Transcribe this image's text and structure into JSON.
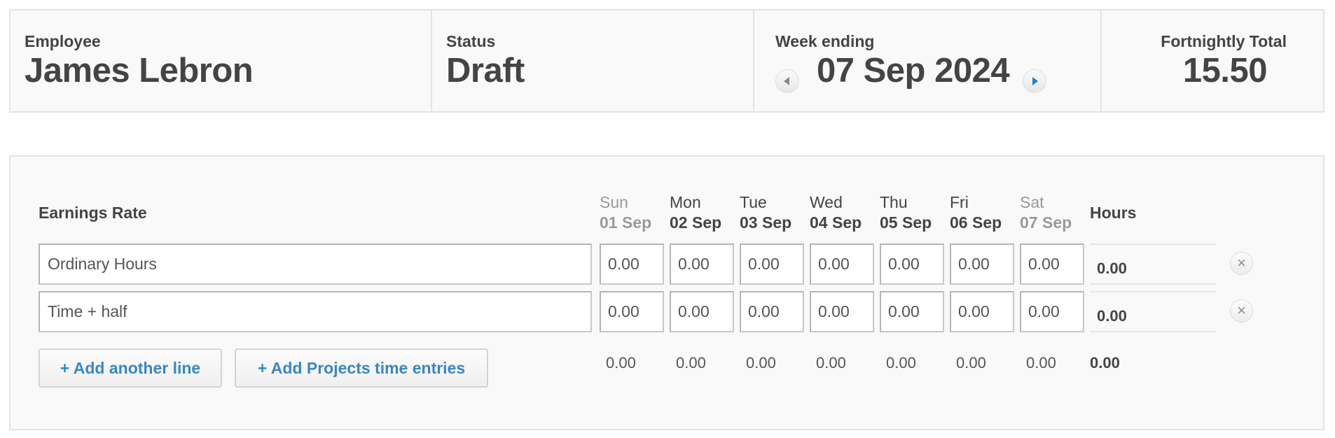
{
  "summary": {
    "employee_label": "Employee",
    "employee_name": "James Lebron",
    "status_label": "Status",
    "status_value": "Draft",
    "week_label": "Week ending",
    "week_value": "07 Sep 2024",
    "prev_week_icon": "triangle-left-icon",
    "next_week_icon": "triangle-right-icon",
    "total_label": "Fortnightly Total",
    "total_value": "15.50"
  },
  "table": {
    "rate_header": "Earnings Rate",
    "hours_header": "Hours",
    "days": [
      {
        "day": "Sun",
        "date": "01 Sep",
        "weekend": true
      },
      {
        "day": "Mon",
        "date": "02 Sep",
        "weekend": false
      },
      {
        "day": "Tue",
        "date": "03 Sep",
        "weekend": false
      },
      {
        "day": "Wed",
        "date": "04 Sep",
        "weekend": false
      },
      {
        "day": "Thu",
        "date": "05 Sep",
        "weekend": false
      },
      {
        "day": "Fri",
        "date": "06 Sep",
        "weekend": false
      },
      {
        "day": "Sat",
        "date": "07 Sep",
        "weekend": true
      }
    ],
    "rows": [
      {
        "rate": "Ordinary Hours",
        "values": [
          "0.00",
          "0.00",
          "0.00",
          "0.00",
          "0.00",
          "0.00",
          "0.00"
        ],
        "total": "0.00",
        "remove_icon": "close-icon"
      },
      {
        "rate": "Time + half",
        "values": [
          "0.00",
          "0.00",
          "0.00",
          "0.00",
          "0.00",
          "0.00",
          "0.00"
        ],
        "total": "0.00",
        "remove_icon": "close-icon"
      }
    ],
    "day_totals": [
      "0.00",
      "0.00",
      "0.00",
      "0.00",
      "0.00",
      "0.00",
      "0.00"
    ],
    "grand_total": "0.00"
  },
  "actions": {
    "add_line": "+ Add another line",
    "add_projects": "+ Add Projects time entries"
  },
  "colors": {
    "accent": "#3a87bf",
    "next_arrow": "#2a7fc0",
    "weekend_text": "#9a9a9a"
  }
}
